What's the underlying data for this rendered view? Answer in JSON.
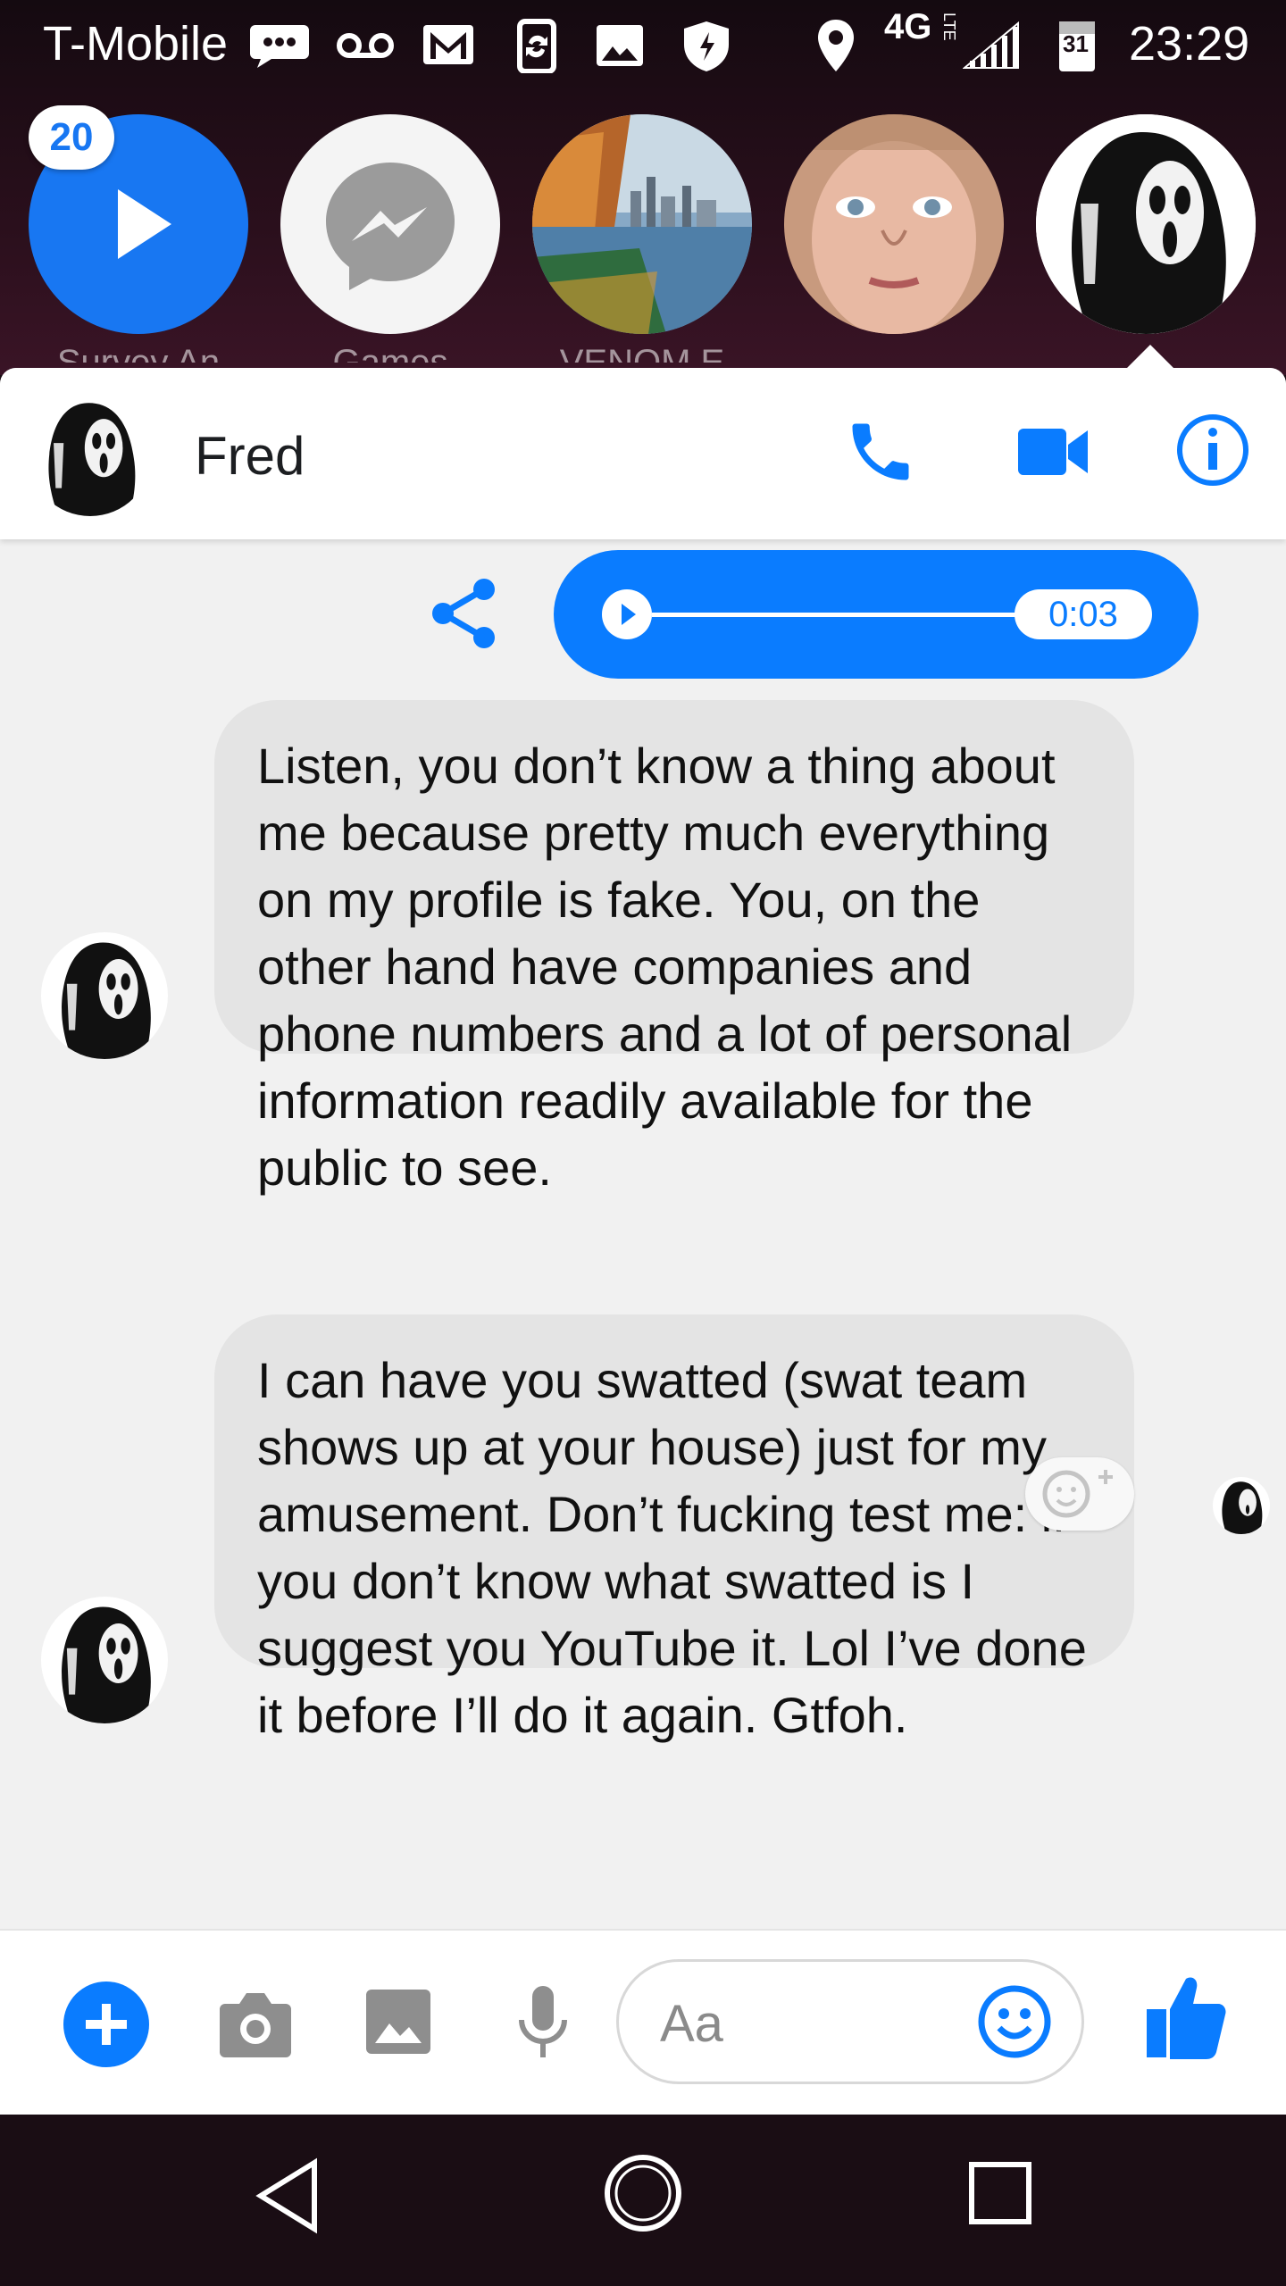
{
  "status_bar": {
    "carrier": "T-Mobile",
    "network": "4G",
    "network_sub": "LTE",
    "calendar_day": "31",
    "time": "23:29",
    "icons": [
      "messaging-icon",
      "voicemail-icon",
      "gmail-icon",
      "sync-icon",
      "image-icon",
      "shield-icon",
      "location-icon",
      "signal-icon",
      "calendar-icon"
    ]
  },
  "chat_heads": {
    "badge_count": "20",
    "items": [
      {
        "label": "Survey An",
        "icon": "play-icon"
      },
      {
        "label": "Games",
        "icon": "messenger-icon"
      },
      {
        "label": "VENOM E",
        "icon": "lake-photo"
      },
      {
        "label": "",
        "icon": "face-photo"
      },
      {
        "label": "",
        "icon": "ghostface-photo"
      }
    ]
  },
  "header": {
    "contact_name": "Fred",
    "actions": [
      "phone-icon",
      "video-icon",
      "info-icon"
    ],
    "accent": "#0a7cff"
  },
  "audio_message": {
    "duration": "0:03",
    "progress": 0
  },
  "messages": [
    {
      "text": "Listen, you don’t know a thing about me because pretty much everything on my profile is fake. You, on the other hand have companies and phone numbers and a lot of personal information readily available for the public to see."
    },
    {
      "text": "I can have you swatted (swat team shows up at your house) just for my amusement. Don’t fucking test me: if you don’t know what swatted is I suggest you YouTube it. Lol I’ve done it before I’ll do it again. Gtfoh."
    }
  ],
  "composer": {
    "placeholder": "Aa",
    "icons": [
      "plus-icon",
      "camera-icon",
      "gallery-icon",
      "microphone-icon",
      "emoji-icon",
      "thumbs-up-icon"
    ]
  },
  "nav_bar": {
    "buttons": [
      "back-icon",
      "home-icon",
      "recents-icon"
    ]
  }
}
